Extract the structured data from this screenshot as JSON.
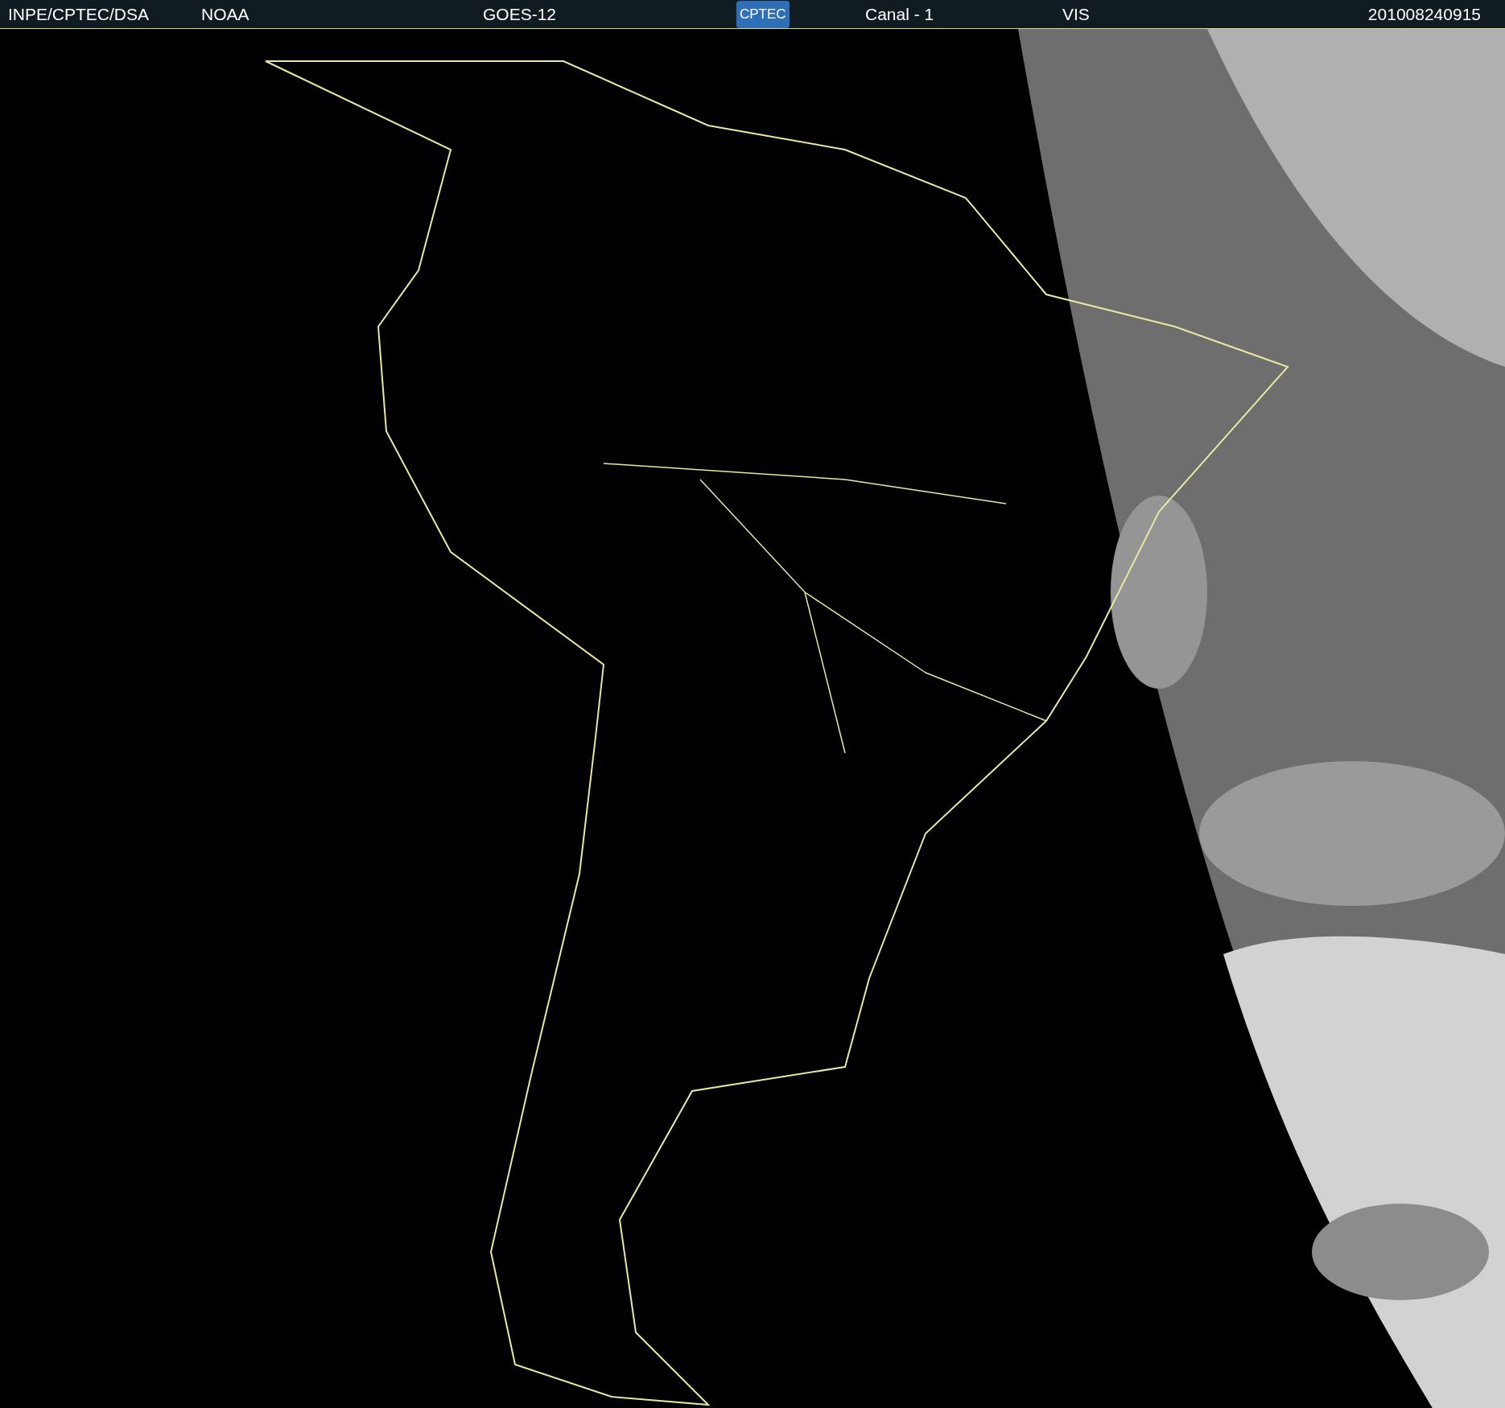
{
  "header": {
    "items": [
      {
        "kind": "text",
        "label": "INPE/CPTEC/DSA"
      },
      {
        "kind": "text",
        "label": "NOAA"
      },
      {
        "kind": "text",
        "label": "GOES-12"
      },
      {
        "kind": "logo",
        "label": "CPTEC"
      },
      {
        "kind": "text",
        "label": "Canal - 1"
      },
      {
        "kind": "text",
        "label": "VIS"
      },
      {
        "kind": "text",
        "label": "201008240915"
      }
    ]
  }
}
